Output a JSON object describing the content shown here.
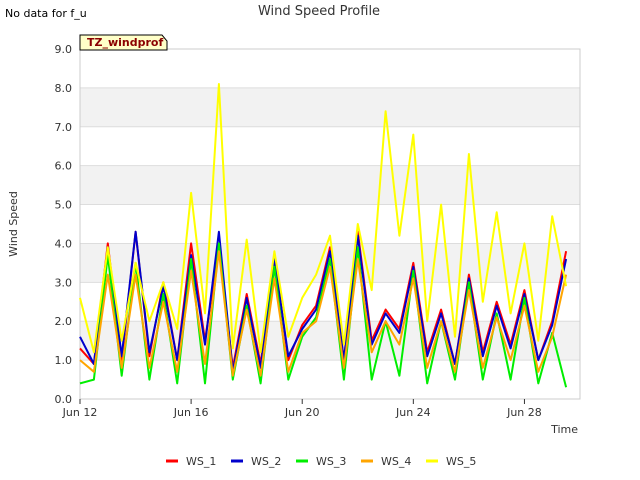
{
  "note": "No data for f_u",
  "chart_data": {
    "type": "line",
    "title": "Wind Speed Profile",
    "site_label": "TZ_windprof",
    "xlabel": "Time",
    "ylabel": "Wind Speed",
    "ylim": [
      0.0,
      9.0
    ],
    "yticks": [
      "0.0",
      "1.0",
      "2.0",
      "3.0",
      "4.0",
      "5.0",
      "6.0",
      "7.0",
      "8.0",
      "9.0"
    ],
    "xlim": [
      "2024-06-12",
      "2024-06-30"
    ],
    "xticks": [
      {
        "date": "2024-06-12",
        "label": "Jun 12"
      },
      {
        "date": "2024-06-16",
        "label": "Jun 16"
      },
      {
        "date": "2024-06-20",
        "label": "Jun 20"
      },
      {
        "date": "2024-06-24",
        "label": "Jun 24"
      },
      {
        "date": "2024-06-28",
        "label": "Jun 28"
      }
    ],
    "grid": true,
    "legend_position": "bottom",
    "x": [
      "2024-06-12",
      "2024-06-12.5",
      "2024-06-13",
      "2024-06-13.5",
      "2024-06-14",
      "2024-06-14.5",
      "2024-06-15",
      "2024-06-15.5",
      "2024-06-16",
      "2024-06-16.5",
      "2024-06-17",
      "2024-06-17.5",
      "2024-06-18",
      "2024-06-18.5",
      "2024-06-19",
      "2024-06-19.5",
      "2024-06-20",
      "2024-06-20.5",
      "2024-06-21",
      "2024-06-21.5",
      "2024-06-22",
      "2024-06-22.5",
      "2024-06-23",
      "2024-06-23.5",
      "2024-06-24",
      "2024-06-24.5",
      "2024-06-25",
      "2024-06-25.5",
      "2024-06-26",
      "2024-06-26.5",
      "2024-06-27",
      "2024-06-27.5",
      "2024-06-28",
      "2024-06-28.5",
      "2024-06-29",
      "2024-06-29.5"
    ],
    "series": [
      {
        "name": "WS_1",
        "color": "#ff0000",
        "values": [
          1.3,
          0.9,
          4.0,
          1.0,
          4.3,
          1.1,
          3.0,
          1.0,
          4.0,
          1.5,
          3.9,
          0.8,
          2.7,
          0.9,
          3.7,
          1.0,
          1.9,
          2.4,
          3.9,
          1.0,
          4.3,
          1.5,
          2.3,
          1.8,
          3.5,
          1.2,
          2.3,
          0.9,
          3.2,
          1.2,
          2.5,
          1.4,
          2.8,
          1.0,
          2.0,
          3.8
        ]
      },
      {
        "name": "WS_2",
        "color": "#0000cc",
        "values": [
          1.6,
          0.9,
          3.9,
          1.1,
          4.3,
          1.2,
          2.9,
          1.0,
          3.7,
          1.4,
          4.3,
          0.7,
          2.6,
          0.8,
          3.6,
          1.1,
          1.8,
          2.3,
          3.8,
          1.0,
          4.2,
          1.4,
          2.2,
          1.7,
          3.4,
          1.1,
          2.2,
          0.9,
          3.1,
          1.1,
          2.4,
          1.3,
          2.7,
          1.0,
          1.9,
          3.6
        ]
      },
      {
        "name": "WS_3",
        "color": "#00ee00",
        "values": [
          0.4,
          0.5,
          3.7,
          0.6,
          3.5,
          0.5,
          2.7,
          0.4,
          3.6,
          0.4,
          4.0,
          0.5,
          2.4,
          0.4,
          3.4,
          0.5,
          1.6,
          2.1,
          3.6,
          0.5,
          3.9,
          0.5,
          2.0,
          0.6,
          3.3,
          0.4,
          2.0,
          0.5,
          3.0,
          0.5,
          2.2,
          0.5,
          2.6,
          0.4,
          1.7,
          0.3
        ]
      },
      {
        "name": "WS_4",
        "color": "#ffa500",
        "values": [
          1.0,
          0.7,
          3.2,
          0.8,
          3.2,
          0.8,
          2.5,
          0.7,
          3.3,
          0.9,
          3.8,
          0.6,
          2.3,
          0.6,
          3.1,
          0.7,
          1.7,
          2.0,
          3.4,
          0.8,
          3.6,
          1.2,
          2.0,
          1.4,
          3.1,
          0.8,
          2.0,
          0.7,
          2.8,
          0.8,
          2.1,
          1.0,
          2.4,
          0.7,
          1.6,
          3.2
        ]
      },
      {
        "name": "WS_5",
        "color": "#ffff00",
        "values": [
          2.6,
          1.2,
          3.9,
          1.5,
          3.5,
          2.0,
          3.0,
          1.8,
          5.3,
          2.2,
          8.1,
          1.3,
          4.1,
          1.2,
          3.8,
          1.6,
          2.6,
          3.2,
          4.2,
          1.4,
          4.5,
          2.8,
          7.4,
          4.2,
          6.8,
          2.0,
          5.0,
          1.6,
          6.3,
          2.5,
          4.8,
          2.2,
          4.0,
          1.5,
          4.7,
          2.9
        ]
      }
    ]
  }
}
